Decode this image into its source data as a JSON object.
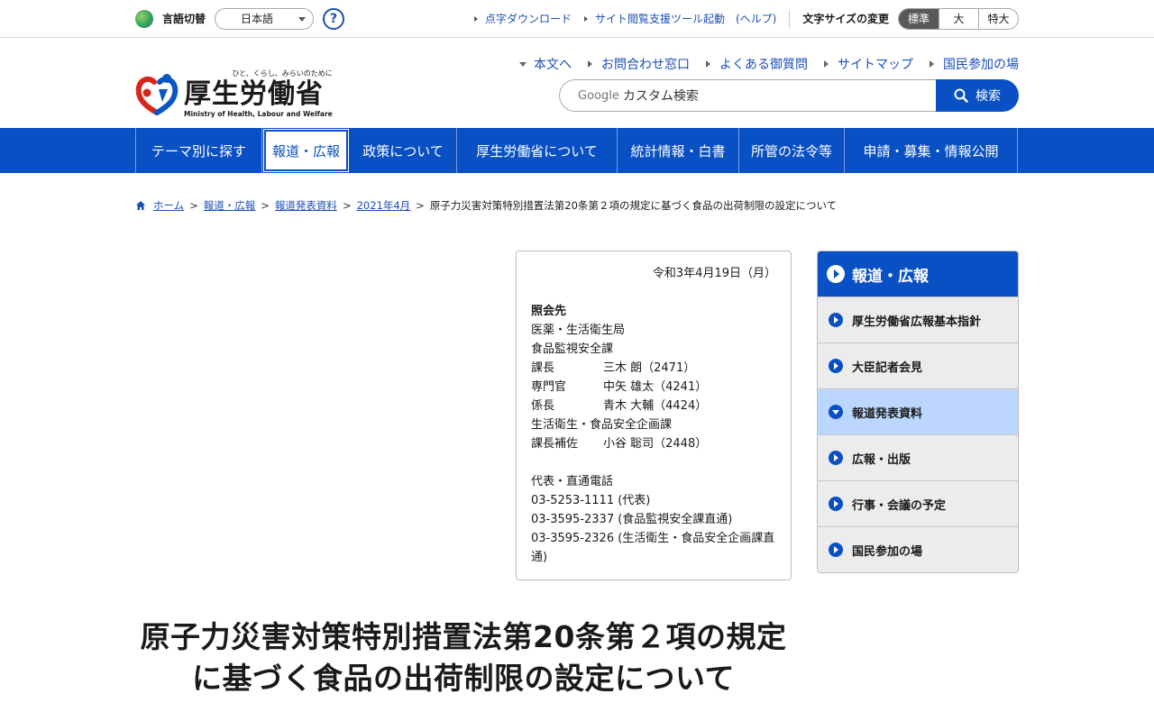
{
  "utility": {
    "lang_label": "言語切替",
    "lang_value": "日本語",
    "help_symbol": "?",
    "links": [
      {
        "label": "点字ダウンロード"
      },
      {
        "label": "サイト閲覧支援ツール起動　(ヘルプ)"
      }
    ],
    "font_size_label": "文字サイズの変更",
    "font_sizes": [
      "標準",
      "大",
      "特大"
    ],
    "font_size_selected": "標準"
  },
  "header": {
    "logo_tagline": "ひと、くらし、みらいのために",
    "logo_name": "厚生労働省",
    "logo_en": "Ministry of Health, Labour and Welfare",
    "quick_links": [
      "本文へ",
      "お問合わせ窓口",
      "よくある御質問",
      "サイトマップ",
      "国民参加の場"
    ],
    "search_brand": "Google",
    "search_placeholder": "カスタム検索",
    "search_button": "検索"
  },
  "gnav": {
    "items": [
      "テーマ別に探す",
      "報道・広報",
      "政策について",
      "厚生労働省について",
      "統計情報・白書",
      "所管の法令等",
      "申請・募集・情報公開"
    ],
    "active": "報道・広報"
  },
  "breadcrumb": {
    "items": [
      "ホーム",
      "報道・広報",
      "報道発表資料",
      "2021年4月"
    ],
    "current": "原子力災害対策特別措置法第20条第２項の規定に基づく食品の出荷制限の設定について"
  },
  "contact": {
    "date": "令和3年4月19日（月）",
    "heading": "照会先",
    "bureau": "医薬・生活衛生局",
    "division": "食品監視安全課",
    "staff1": [
      {
        "title": "課長",
        "name": "三木 朗（2471）"
      },
      {
        "title": "専門官",
        "name": "中矢 雄太（4241）"
      },
      {
        "title": "係長",
        "name": "青木 大輔（4424）"
      }
    ],
    "division2": "生活衛生・食品安全企画課",
    "staff2": [
      {
        "title": "課長補佐",
        "name": "小谷 聡司（2448）"
      }
    ],
    "phone_heading": "代表・直通電話",
    "phones": [
      "03-5253-1111 (代表)",
      "03-3595-2337 (食品監視安全課直通)",
      "03-3595-2326 (生活衛生・食品安全企画課直通)"
    ]
  },
  "side": {
    "heading": "報道・広報",
    "items": [
      "厚生労働省広報基本指針",
      "大臣記者会見",
      "報道発表資料",
      "広報・出版",
      "行事・会議の予定",
      "国民参加の場"
    ],
    "current": "報道発表資料"
  },
  "title": "原子力災害対策特別措置法第20条第２項の規定に基づく食品の出荷制限の設定について",
  "colors": {
    "brand_blue": "#0950c4",
    "link_blue": "#1d4fb8",
    "current_bg": "#bcd7ff"
  }
}
